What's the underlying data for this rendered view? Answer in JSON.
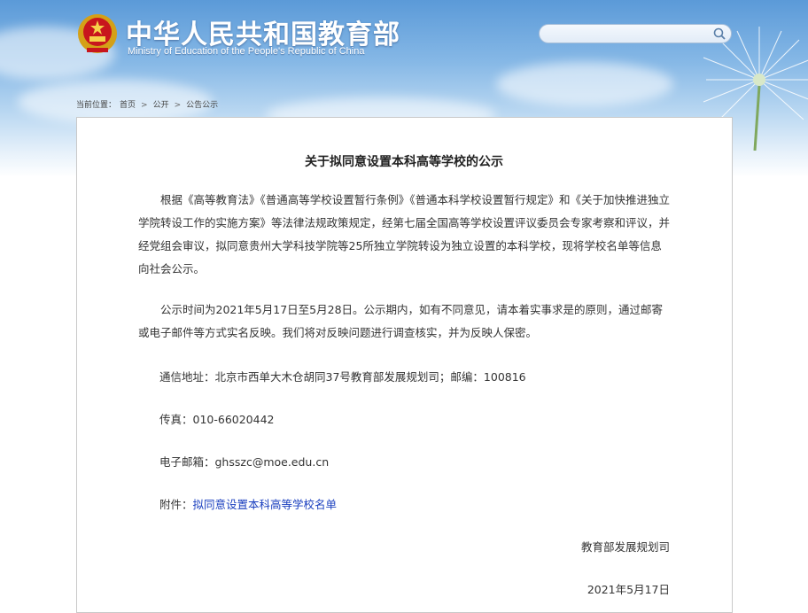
{
  "header": {
    "title_cn": "中华人民共和国教育部",
    "title_en": "Ministry of Education of the People's Republic of China",
    "search": {
      "placeholder": ""
    }
  },
  "breadcrumb": {
    "prefix": "当前位置：",
    "items": [
      "首页",
      "公开",
      "公告公示"
    ]
  },
  "article": {
    "title": "关于拟同意设置本科高等学校的公示",
    "para1": "根据《高等教育法》《普通高等学校设置暂行条例》《普通本科学校设置暂行规定》和《关于加快推进独立学院转设工作的实施方案》等法律法规政策规定，经第七届全国高等学校设置评议委员会专家考察和评议，并经党组会审议，拟同意贵州大学科技学院等25所独立学院转设为独立设置的本科学校，现将学校名单等信息向社会公示。",
    "para2": "公示时间为2021年5月17日至5月28日。公示期内，如有不同意见，请本着实事求是的原则，通过邮寄或电子邮件等方式实名反映。我们将对反映问题进行调查核实，并为反映人保密。",
    "address": "通信地址：北京市西单大木仓胡同37号教育部发展规划司；邮编：100816",
    "fax": "传真：010-66020442",
    "email": "电子邮箱：ghsszc@moe.edu.cn",
    "attachment_label": "附件：",
    "attachment_link": "拟同意设置本科高等学校名单",
    "signature": "教育部发展规划司",
    "date": "2021年5月17日"
  },
  "colors": {
    "header_sky": "#5b9ad8",
    "link": "#1a3fbf",
    "text": "#333333",
    "border": "#c9c9c9"
  },
  "icons": [
    "national-emblem-icon",
    "search-icon",
    "dandelion-decoration"
  ]
}
